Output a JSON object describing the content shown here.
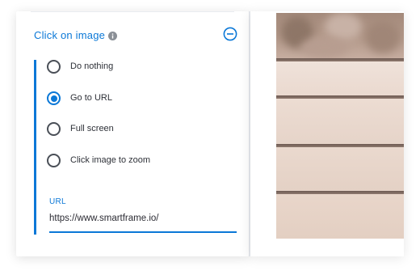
{
  "settings": {
    "title": "Click on image",
    "options": [
      {
        "label": "Do nothing",
        "selected": false
      },
      {
        "label": "Go to URL",
        "selected": true
      },
      {
        "label": "Full screen",
        "selected": false
      },
      {
        "label": "Click image to zoom",
        "selected": false
      }
    ],
    "url": {
      "label": "URL",
      "value": "https://www.smartframe.io/"
    }
  },
  "icons": {
    "info": "info-icon",
    "collapse": "minus-circle-icon",
    "radio_unchecked": "radio-unchecked-icon",
    "radio_checked": "radio-checked-icon"
  },
  "colors": {
    "accent": "#0b78d7",
    "text": "#2b2b33",
    "info_icon": "#8a8f96"
  }
}
